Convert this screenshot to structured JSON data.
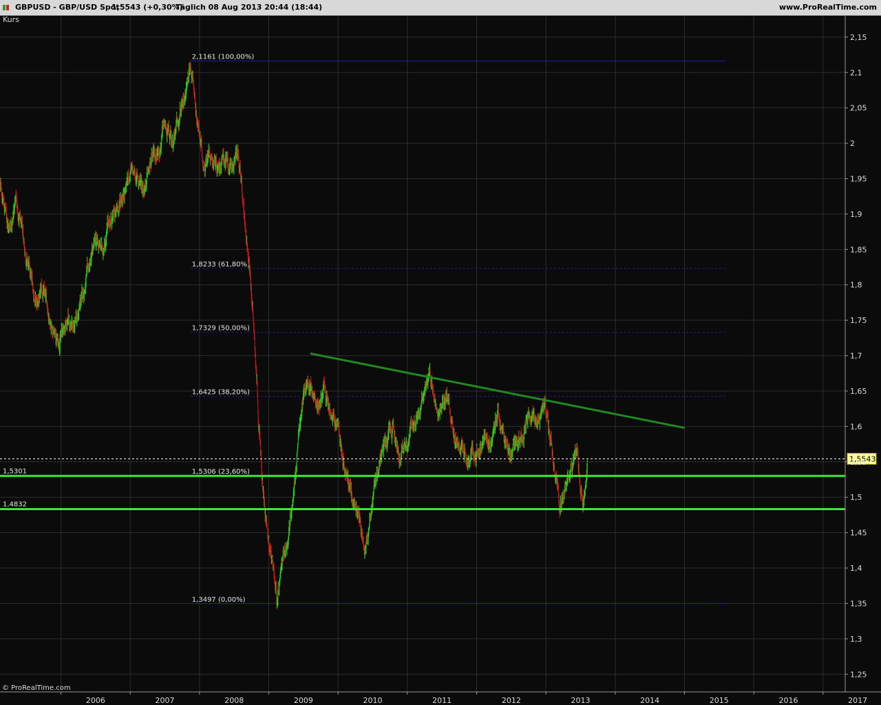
{
  "header": {
    "symbol": "GBPUSD - GBP/USD Spot",
    "price_change": "1,5543 (+0,30%)",
    "period_date": "Täglich  08 Aug 2013 20:44 (18:44)",
    "site": "www.ProRealTime.com"
  },
  "indicator_label": "Kurs",
  "copyright": "© ProRealTime.com",
  "colors": {
    "background": "#0b0b0b",
    "grid": "#2e2e2e",
    "up_bar": "#22dd22",
    "down_bar": "#cc1a1a",
    "fib_line": "#1c1cb0",
    "support_line": "#33ee33",
    "trend_line": "#1f8a1f",
    "price_tag": "#ffff99"
  },
  "chart_data": {
    "type": "ohlc",
    "instrument": "GBP/USD",
    "x_ticks": [
      "2006",
      "2007",
      "2008",
      "2009",
      "2010",
      "2011",
      "2012",
      "2013",
      "2014",
      "2015",
      "2016",
      "2017"
    ],
    "y_ticks": [
      "2,15",
      "2,1",
      "2,05",
      "2",
      "1,95",
      "1,9",
      "1,85",
      "1,8",
      "1,75",
      "1,7",
      "1,65",
      "1,6",
      "1,55",
      "1,5",
      "1,45",
      "1,4",
      "1,35",
      "1,3",
      "1,25"
    ],
    "y_tick_values": [
      2.15,
      2.1,
      2.05,
      2,
      1.95,
      1.9,
      1.85,
      1.8,
      1.75,
      1.7,
      1.65,
      1.6,
      1.55,
      1.5,
      1.45,
      1.4,
      1.35,
      1.3,
      1.25
    ],
    "ylim": [
      1.225,
      2.18
    ],
    "xlim": [
      2005.12,
      2017.32
    ],
    "last_price": 1.5543,
    "last_price_label": "1,5543",
    "price_path": [
      [
        2005.12,
        1.94
      ],
      [
        2005.25,
        1.88
      ],
      [
        2005.35,
        1.92
      ],
      [
        2005.5,
        1.84
      ],
      [
        2005.65,
        1.77
      ],
      [
        2005.75,
        1.79
      ],
      [
        2005.85,
        1.75
      ],
      [
        2005.95,
        1.72
      ],
      [
        2006.1,
        1.75
      ],
      [
        2006.2,
        1.74
      ],
      [
        2006.3,
        1.78
      ],
      [
        2006.4,
        1.82
      ],
      [
        2006.5,
        1.86
      ],
      [
        2006.6,
        1.85
      ],
      [
        2006.7,
        1.89
      ],
      [
        2006.8,
        1.9
      ],
      [
        2006.9,
        1.93
      ],
      [
        2007.0,
        1.96
      ],
      [
        2007.1,
        1.95
      ],
      [
        2007.2,
        1.94
      ],
      [
        2007.3,
        1.97
      ],
      [
        2007.4,
        1.99
      ],
      [
        2007.5,
        2.02
      ],
      [
        2007.6,
        2.0
      ],
      [
        2007.7,
        2.03
      ],
      [
        2007.8,
        2.07
      ],
      [
        2007.87,
        2.1161
      ],
      [
        2007.95,
        2.05
      ],
      [
        2008.05,
        1.97
      ],
      [
        2008.15,
        1.99
      ],
      [
        2008.25,
        1.97
      ],
      [
        2008.35,
        1.98
      ],
      [
        2008.45,
        1.96
      ],
      [
        2008.55,
        1.99
      ],
      [
        2008.6,
        1.94
      ],
      [
        2008.7,
        1.85
      ],
      [
        2008.75,
        1.79
      ],
      [
        2008.8,
        1.72
      ],
      [
        2008.85,
        1.62
      ],
      [
        2008.9,
        1.53
      ],
      [
        2008.95,
        1.47
      ],
      [
        2009.0,
        1.44
      ],
      [
        2009.1,
        1.38
      ],
      [
        2009.12,
        1.3497
      ],
      [
        2009.2,
        1.4
      ],
      [
        2009.3,
        1.46
      ],
      [
        2009.4,
        1.55
      ],
      [
        2009.5,
        1.65
      ],
      [
        2009.6,
        1.66
      ],
      [
        2009.7,
        1.63
      ],
      [
        2009.8,
        1.65
      ],
      [
        2009.9,
        1.61
      ],
      [
        2010.0,
        1.6
      ],
      [
        2010.1,
        1.54
      ],
      [
        2010.2,
        1.5
      ],
      [
        2010.3,
        1.47
      ],
      [
        2010.38,
        1.43
      ],
      [
        2010.5,
        1.5
      ],
      [
        2010.6,
        1.55
      ],
      [
        2010.7,
        1.58
      ],
      [
        2010.8,
        1.59
      ],
      [
        2010.9,
        1.56
      ],
      [
        2011.0,
        1.58
      ],
      [
        2011.1,
        1.61
      ],
      [
        2011.2,
        1.63
      ],
      [
        2011.32,
        1.67
      ],
      [
        2011.45,
        1.63
      ],
      [
        2011.6,
        1.64
      ],
      [
        2011.7,
        1.58
      ],
      [
        2011.8,
        1.56
      ],
      [
        2011.9,
        1.55
      ],
      [
        2012.0,
        1.56
      ],
      [
        2012.1,
        1.58
      ],
      [
        2012.2,
        1.57
      ],
      [
        2012.3,
        1.62
      ],
      [
        2012.4,
        1.58
      ],
      [
        2012.5,
        1.56
      ],
      [
        2012.6,
        1.57
      ],
      [
        2012.75,
        1.62
      ],
      [
        2012.9,
        1.61
      ],
      [
        2013.0,
        1.63
      ],
      [
        2013.05,
        1.58
      ],
      [
        2013.15,
        1.53
      ],
      [
        2013.2,
        1.49
      ],
      [
        2013.3,
        1.53
      ],
      [
        2013.4,
        1.55
      ],
      [
        2013.45,
        1.57
      ],
      [
        2013.5,
        1.51
      ],
      [
        2013.55,
        1.5
      ],
      [
        2013.6,
        1.5543
      ]
    ],
    "fibonacci": [
      {
        "level": 2.1161,
        "label": "2,1161 (100,00%)"
      },
      {
        "level": 1.8233,
        "label": "1,8233 (61,80%)"
      },
      {
        "level": 1.7329,
        "label": "1,7329 (50,00%)"
      },
      {
        "level": 1.6425,
        "label": "1,6425 (38,20%)"
      },
      {
        "level": 1.5306,
        "label": "1,5306 (23,60%)"
      },
      {
        "level": 1.3497,
        "label": "1,3497 (0,00%)"
      }
    ],
    "fib_x_range": [
      2007.87,
      2015.6
    ],
    "support_lines": [
      {
        "level": 1.5301,
        "label": "1,5301"
      },
      {
        "level": 1.4832,
        "label": "1,4832"
      }
    ],
    "trend_line": {
      "x1": 2009.6,
      "y1": 1.703,
      "x2": 2015.0,
      "y2": 1.598
    }
  }
}
